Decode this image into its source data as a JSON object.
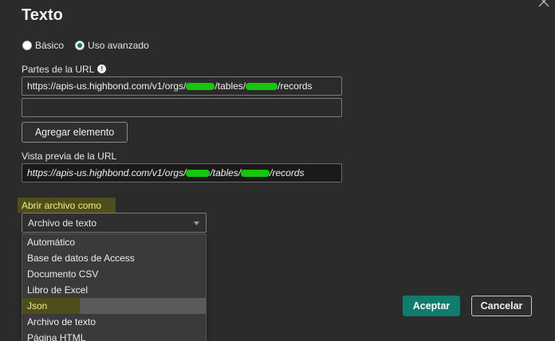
{
  "dialog": {
    "title": "Texto",
    "close_icon": "close-icon"
  },
  "mode": {
    "options": [
      {
        "label": "Básico",
        "selected": false
      },
      {
        "label": "Uso avanzado",
        "selected": true
      }
    ]
  },
  "url_parts": {
    "label": "Partes de la URL",
    "info_icon": "info-icon",
    "field1_value_parts": [
      "https://apis-us.highbond.com/v1/orgs/",
      "/tables/",
      "/records"
    ],
    "field2_value": "",
    "add_button": "Agregar elemento"
  },
  "preview": {
    "label": "Vista previa de la URL",
    "value_parts": [
      "https://apis-us.highbond.com/v1/orgs/",
      "/tables/",
      "/records"
    ]
  },
  "open_as": {
    "label": "Abrir archivo como",
    "selected": "Archivo de texto",
    "options": [
      "Automático",
      "Base de datos de Access",
      "Documento CSV",
      "Libro de Excel",
      "Json",
      "Archivo de texto",
      "Página HTML"
    ],
    "hovered_index": 4
  },
  "footer": {
    "accept": "Aceptar",
    "cancel": "Cancelar"
  },
  "colors": {
    "background": "#2b2b2b",
    "accent": "#107c6b",
    "highlight": "#4e4d1c",
    "highlight_text": "#f4f07a",
    "redaction": "#16c60c"
  }
}
